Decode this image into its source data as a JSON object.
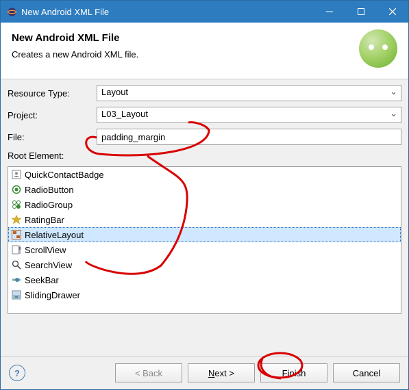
{
  "titlebar": {
    "title": "New Android XML File"
  },
  "header": {
    "title": "New Android XML File",
    "subtitle": "Creates a new Android XML file."
  },
  "form": {
    "resource_type_label": "Resource Type:",
    "resource_type_value": "Layout",
    "project_label": "Project:",
    "project_value": "L03_Layout",
    "file_label": "File:",
    "file_value": "padding_margin",
    "root_element_label": "Root Element:"
  },
  "root_elements": [
    {
      "label": "QuickContactBadge",
      "icon": "contact-badge-icon",
      "selected": false
    },
    {
      "label": "RadioButton",
      "icon": "radio-button-icon",
      "selected": false
    },
    {
      "label": "RadioGroup",
      "icon": "radio-group-icon",
      "selected": false
    },
    {
      "label": "RatingBar",
      "icon": "rating-star-icon",
      "selected": false
    },
    {
      "label": "RelativeLayout",
      "icon": "relative-layout-icon",
      "selected": true
    },
    {
      "label": "ScrollView",
      "icon": "scroll-view-icon",
      "selected": false
    },
    {
      "label": "SearchView",
      "icon": "search-icon",
      "selected": false
    },
    {
      "label": "SeekBar",
      "icon": "seekbar-icon",
      "selected": false
    },
    {
      "label": "SlidingDrawer",
      "icon": "sliding-drawer-icon",
      "selected": false
    }
  ],
  "buttons": {
    "back": "< Back",
    "next": "Next >",
    "finish": "Finish",
    "cancel": "Cancel"
  }
}
